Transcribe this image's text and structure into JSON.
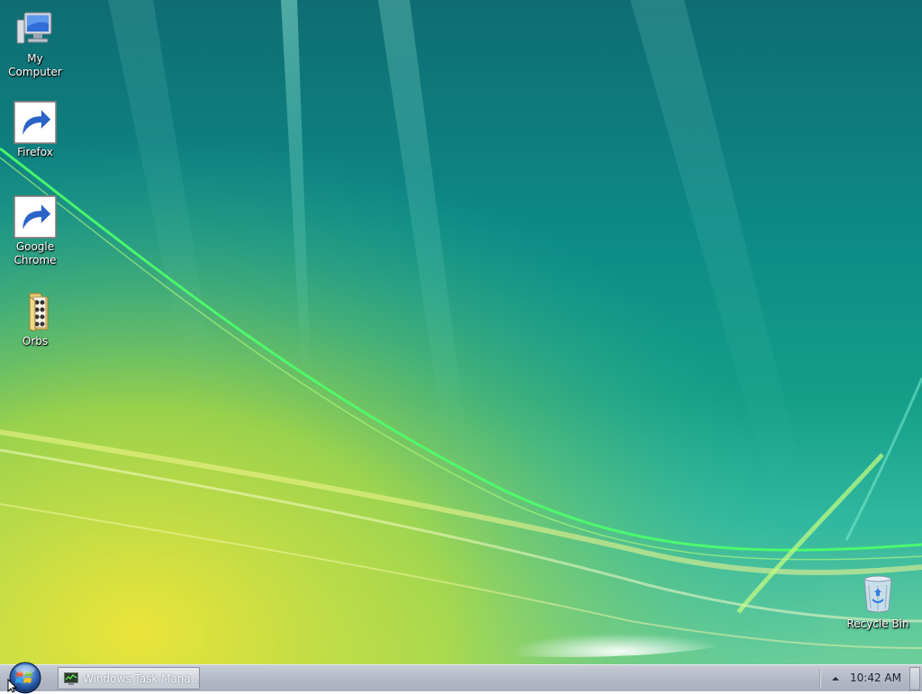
{
  "desktop": {
    "icons": [
      {
        "label": "My Computer",
        "icon": "computer-icon"
      },
      {
        "label": "Firefox",
        "icon": "firefox-icon"
      },
      {
        "label": "Google\nChrome",
        "icon": "chrome-icon"
      },
      {
        "label": "Orbs",
        "icon": "folder-icon"
      },
      {
        "label": "Recycle Bin",
        "icon": "recycle-bin-icon"
      }
    ]
  },
  "taskbar": {
    "start_icon": "windows-orb-icon",
    "task_button_label": "Windows Task Mana...",
    "task_button_icon": "task-manager-icon",
    "tray_chevron_icon": "chevron-up-icon",
    "clock": "10:42 AM"
  },
  "colors": {
    "wallpaper_top": "#0f6c73",
    "wallpaper_glow": "#e6e640",
    "taskbar": "#b6bcc7"
  }
}
